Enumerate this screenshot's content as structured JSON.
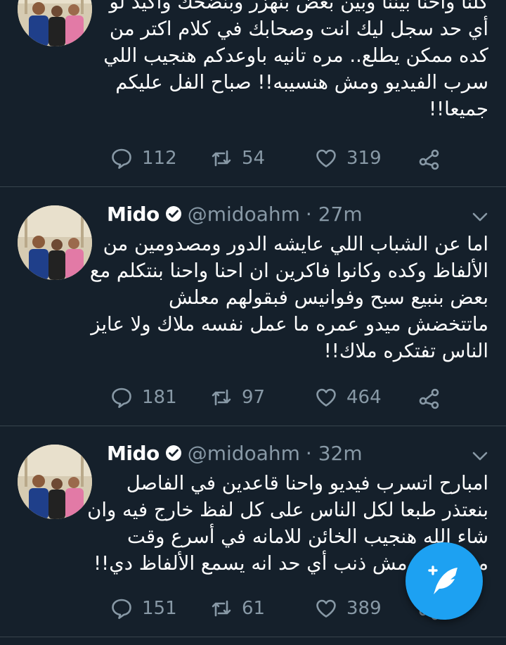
{
  "tweets": [
    {
      "name": "",
      "handle": "",
      "time": "",
      "lines": [
        "كلنا واحنا بيننا وبين بعض بنهزر وبنضحك واكيد لو",
        "أي حد سجل ليك انت وصحابك في كلام اكتر من",
        "كده ممكن يطلع.. مره تانيه باوعدكم هنجيب اللي",
        "سرب الفيديو ومش هنسيبه!! صباح الفل عليكم",
        "جميعا!!"
      ],
      "replies": "112",
      "retweets": "54",
      "likes": "319"
    },
    {
      "name": "Mido",
      "handle": "@midoahm",
      "time": "· 27m",
      "lines": [
        "اما عن الشباب اللي عايشه الدور ومصدومين من",
        "الألفاظ وكده وكانوا فاكرين ان احنا واحنا بنتكلم مع",
        "بعض بنبيع سبح وفوانيس فبقولهم معلش",
        "ماتتخضش ميدو عمره ما عمل نفسه ملاك ولا عايز",
        "الناس تفتكره ملاك!!"
      ],
      "replies": "181",
      "retweets": "97",
      "likes": "464"
    },
    {
      "name": "Mido",
      "handle": "@midoahm",
      "time": "· 32m",
      "lines": [
        "امبارح اتسرب فيديو واحنا قاعدين في الفاصل",
        "بنعتذر طبعا لكل الناس على كل لفظ خارج فيه وان",
        "شاء الله هنجيب الخائن للامانه في أسرع وقت",
        "مع التأكيد مش ذنب أي حد انه يسمع الألفاظ دي!!"
      ],
      "replies": "151",
      "retweets": "61",
      "likes": "389"
    }
  ],
  "icons": {
    "reply": "reply-icon",
    "retweet": "retweet-icon",
    "like": "heart-icon",
    "share": "share-icon",
    "verified": "verified-badge-icon",
    "chevron": "chevron-down-icon",
    "compose": "compose-tweet-icon"
  },
  "colors": {
    "background": "#15202b",
    "text": "#ffffff",
    "secondary": "#8899a6",
    "accent": "#1da1f2",
    "divider": "#38444d"
  }
}
